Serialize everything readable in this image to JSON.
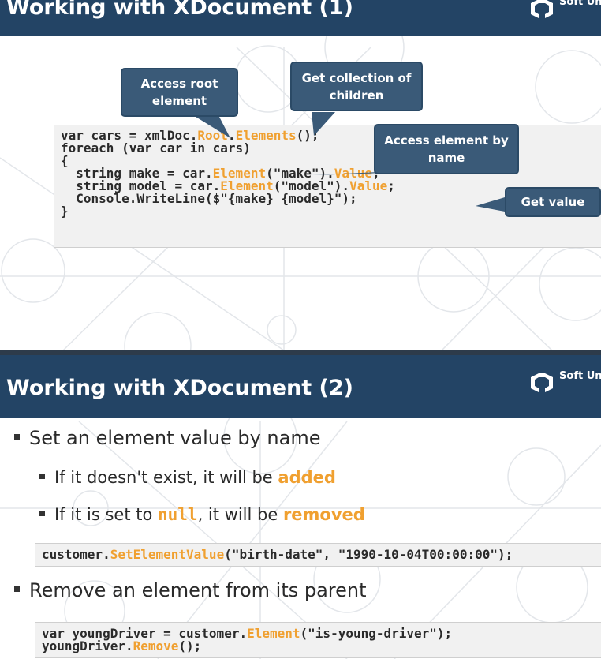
{
  "slide1": {
    "title": "Working with XDocument (1)",
    "logo_text": "Soft Uni",
    "code_lines": [
      [
        {
          "t": "var cars = xmlDoc."
        },
        {
          "t": "Root",
          "h": true
        },
        {
          "t": "."
        },
        {
          "t": "Elements",
          "h": true
        },
        {
          "t": "();"
        }
      ],
      [
        {
          "t": "foreach (var car in cars)"
        }
      ],
      [
        {
          "t": "{"
        }
      ],
      [
        {
          "t": "  string make = car."
        },
        {
          "t": "Element",
          "h": true
        },
        {
          "t": "(\"make\")."
        },
        {
          "t": "Value",
          "h": true
        },
        {
          "t": ";"
        }
      ],
      [
        {
          "t": "  string model = car."
        },
        {
          "t": "Element",
          "h": true
        },
        {
          "t": "(\"model\")."
        },
        {
          "t": "Value",
          "h": true
        },
        {
          "t": ";"
        }
      ],
      [
        {
          "t": "  Console.WriteLine($\"{make} {model}\");"
        }
      ],
      [
        {
          "t": "}"
        }
      ]
    ],
    "callouts": {
      "root": "Access root element",
      "children": "Get collection of children",
      "by_name": "Access element by name",
      "value": "Get value"
    }
  },
  "slide2": {
    "title": "Working with XDocument (2)",
    "logo_text": "Soft Uni",
    "bullet1": "Set an element value by name",
    "sub1_pre": "If it doesn't exist, it will be ",
    "sub1_kw": "added",
    "sub2_pre": "If it is set to ",
    "sub2_code": "null",
    "sub2_mid": ", it will be ",
    "sub2_kw": "removed",
    "code1": [
      [
        {
          "t": "customer."
        },
        {
          "t": "SetElementValue",
          "h": true
        },
        {
          "t": "(\"birth-date\", \"1990-10-04T00:00:00\");"
        }
      ]
    ],
    "bullet2": "Remove an element from its parent",
    "code2": [
      [
        {
          "t": "var youngDriver = customer."
        },
        {
          "t": "Element",
          "h": true
        },
        {
          "t": "(\"is-young-driver\");"
        }
      ],
      [
        {
          "t": "youngDriver."
        },
        {
          "t": "Remove",
          "h": true
        },
        {
          "t": "();"
        }
      ]
    ]
  }
}
